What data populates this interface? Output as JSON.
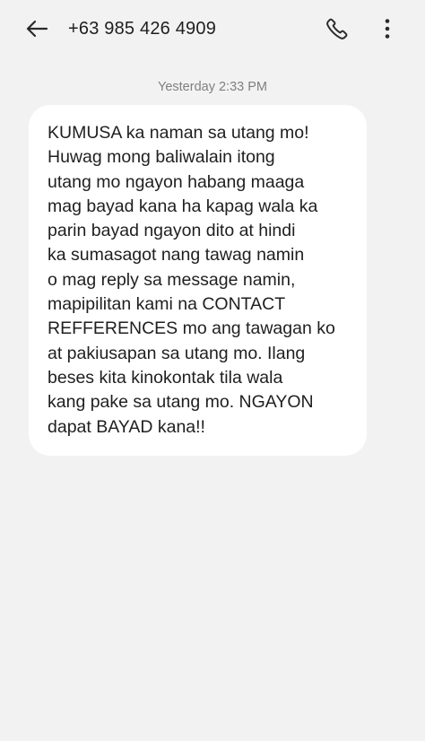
{
  "header": {
    "title": "+63 985 426 4909",
    "back_icon": "arrow-left-icon",
    "call_icon": "phone-icon",
    "more_icon": "more-vertical-icon"
  },
  "conversation": {
    "timestamp": "Yesterday 2:33 PM",
    "message_lines": [
      "KUMUSA ka naman sa utang mo!",
      "Huwag mong baliwalain itong",
      "utang mo ngayon habang maaga",
      "mag bayad kana ha kapag wala ka",
      "parin bayad ngayon dito at hindi",
      "ka sumasagot nang tawag namin",
      "o mag reply sa message namin,",
      "mapipilitan kami na CONTACT",
      "REFFERENCES mo ang tawagan ko",
      "at pakiusapan sa utang mo. Ilang",
      "beses kita kinokontak tila wala",
      "kang pake sa utang mo. NGAYON",
      "dapat BAYAD kana!!"
    ]
  },
  "colors": {
    "background": "#f2f2f2",
    "bubble": "#ffffff",
    "text": "#1f1f1f",
    "timestamp": "#808080"
  }
}
